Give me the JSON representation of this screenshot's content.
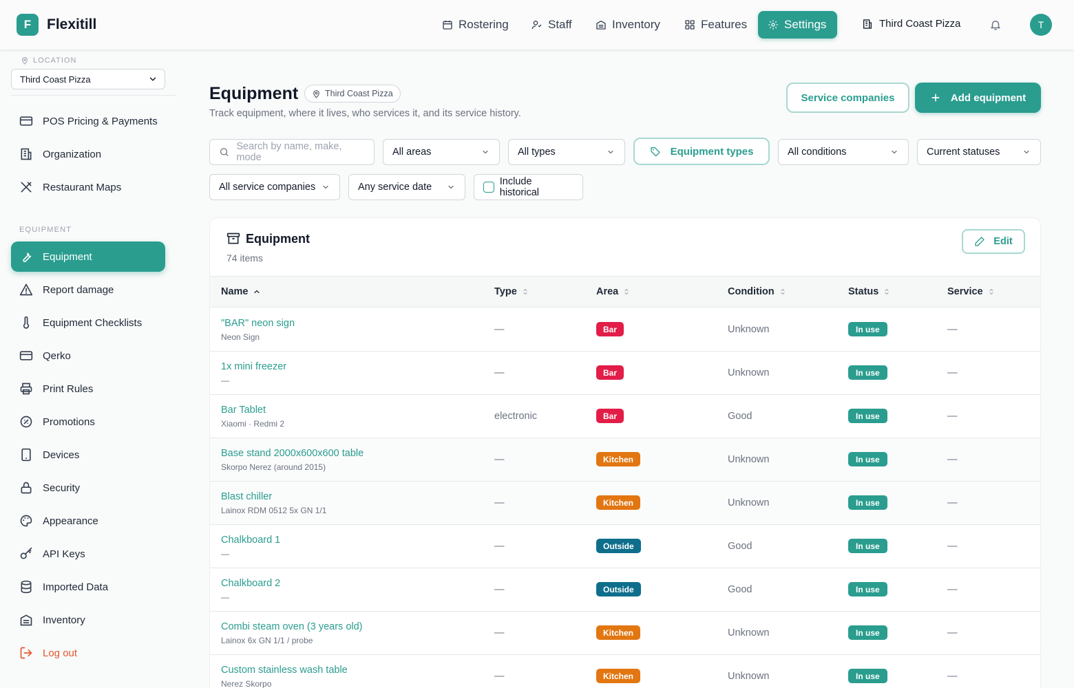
{
  "app": {
    "logo_letter": "F",
    "name": "Flexitill"
  },
  "topnav": [
    {
      "label": "Rostering",
      "icon": "calendar-icon"
    },
    {
      "label": "Staff",
      "icon": "staff-icon"
    },
    {
      "label": "Inventory",
      "icon": "warehouse-icon"
    },
    {
      "label": "Features",
      "icon": "grid-icon"
    },
    {
      "label": "Settings",
      "icon": "gear-icon",
      "active": true
    }
  ],
  "venue": "Third Coast Pizza",
  "user_initial": "T",
  "sidebar": {
    "location_label": "LOCATION",
    "location_value": "Third Coast Pizza",
    "items_top": [
      {
        "label": "POS Pricing & Payments",
        "icon": "card-icon"
      },
      {
        "label": "Organization",
        "icon": "building-icon"
      },
      {
        "label": "Restaurant Maps",
        "icon": "utensils-icon"
      }
    ],
    "section_label": "EQUIPMENT",
    "items": [
      {
        "label": "Equipment",
        "icon": "wrench-icon",
        "active": true
      },
      {
        "label": "Report damage",
        "icon": "warning-icon"
      },
      {
        "label": "Equipment Checklists",
        "icon": "thermometer-icon"
      },
      {
        "label": "Qerko",
        "icon": "card-icon"
      },
      {
        "label": "Print Rules",
        "icon": "printer-icon"
      },
      {
        "label": "Promotions",
        "icon": "badge-percent-icon"
      },
      {
        "label": "Devices",
        "icon": "tablet-icon"
      },
      {
        "label": "Security",
        "icon": "lock-icon"
      },
      {
        "label": "Appearance",
        "icon": "palette-icon"
      },
      {
        "label": "API Keys",
        "icon": "key-icon"
      },
      {
        "label": "Imported Data",
        "icon": "database-icon"
      },
      {
        "label": "Inventory",
        "icon": "warehouse-icon"
      }
    ],
    "logout_label": "Log out"
  },
  "page": {
    "title": "Equipment",
    "location_pill": "Third Coast Pizza",
    "subtitle": "Track equipment, where it lives, who services it, and its service history.",
    "service_companies_label": "Service companies",
    "add_equipment_label": "Add equipment"
  },
  "filters": {
    "search_placeholder": "Search by name, make, mode",
    "areas": "All areas",
    "types": "All types",
    "equipment_types_label": "Equipment types",
    "conditions": "All conditions",
    "statuses": "Current statuses",
    "service_companies": "All service companies",
    "service_date": "Any service date",
    "include_historical": "Include historical"
  },
  "table": {
    "title": "Equipment",
    "count": "74 items",
    "edit_label": "Edit",
    "columns": [
      "Name",
      "Type",
      "Area",
      "Condition",
      "Status",
      "Service"
    ],
    "rows": [
      {
        "name": "\"BAR\" neon sign",
        "sub": "Neon Sign",
        "type": "—",
        "area": "Bar",
        "condition": "Unknown",
        "status": "In use",
        "service": "—"
      },
      {
        "name": "1x mini freezer",
        "sub": "—",
        "type": "—",
        "area": "Bar",
        "condition": "Unknown",
        "status": "In use",
        "service": "—"
      },
      {
        "name": "Bar Tablet",
        "sub": "Xiaomi · Redmi 2",
        "type": "electronic",
        "area": "Bar",
        "condition": "Good",
        "status": "In use",
        "service": "—"
      },
      {
        "name": "Base stand 2000x600x600 table",
        "sub": "Skorpo Nerez (around 2015)",
        "type": "—",
        "area": "Kitchen",
        "condition": "Unknown",
        "status": "In use",
        "service": "—"
      },
      {
        "name": "Blast chiller",
        "sub": "Lainox RDM 0512 5x GN 1/1",
        "type": "—",
        "area": "Kitchen",
        "condition": "Unknown",
        "status": "In use",
        "service": "—"
      },
      {
        "name": "Chalkboard 1",
        "sub": "—",
        "type": "—",
        "area": "Outside",
        "condition": "Good",
        "status": "In use",
        "service": "—"
      },
      {
        "name": "Chalkboard 2",
        "sub": "—",
        "type": "—",
        "area": "Outside",
        "condition": "Good",
        "status": "In use",
        "service": "—"
      },
      {
        "name": "Combi steam oven (3 years old)",
        "sub": "Lainox 6x GN 1/1 / probe",
        "type": "—",
        "area": "Kitchen",
        "condition": "Unknown",
        "status": "In use",
        "service": "—"
      },
      {
        "name": "Custom stainless wash table",
        "sub": "Nerez Skorpo",
        "type": "—",
        "area": "Kitchen",
        "condition": "Unknown",
        "status": "In use",
        "service": "—"
      }
    ]
  },
  "colors": {
    "accent": "#2a9d8f",
    "bar": "#e11d48",
    "kitchen": "#e27611",
    "outside": "#0f6e8c",
    "logout": "#e4572e"
  }
}
